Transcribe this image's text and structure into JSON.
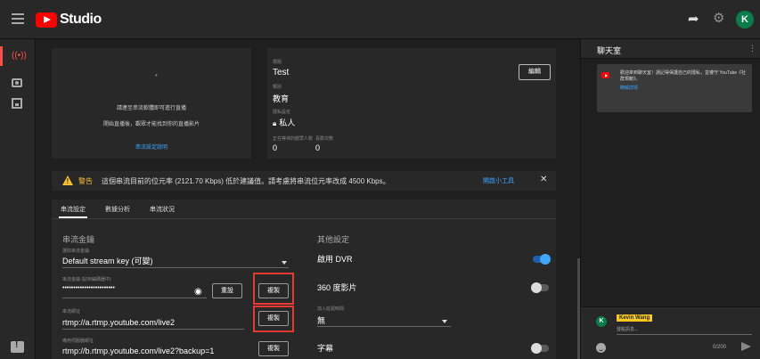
{
  "app": {
    "logo_text": "Studio",
    "avatar_letter": "K"
  },
  "preview": {
    "line1": "請連至串流軟體即可進行直播",
    "line2": "開始直播後，觀眾才能找到你的直播影片",
    "help_link": "串流設定說明"
  },
  "stream_info": {
    "title_label": "標題",
    "title": "Test",
    "category_label": "類別",
    "category": "教育",
    "privacy_label": "隱私設定",
    "privacy": "私人",
    "waiting_label": "正在等待的觀眾人數",
    "waiting": "0",
    "likes_label": "喜歡次數",
    "likes": "0",
    "edit_label": "編輯"
  },
  "warning": {
    "label": "警告",
    "text": "這個串流目前的位元率 (2121.70 Kbps) 低於建議值。請考慮將串流位元率改成 4500 Kbps。",
    "link": "開啟小工具"
  },
  "tabs": [
    {
      "label": "串流設定"
    },
    {
      "label": "數據分析"
    },
    {
      "label": "串流狀況"
    }
  ],
  "stream_key": {
    "section_title": "串流金鑰",
    "select_label": "選取串流金鑰",
    "select_value": "Default stream key (可變)",
    "key_label": "串流金鑰 (貼到編碼器中)",
    "key_value": "••••••••••••••••••••••••",
    "reset_label": "重設",
    "copy_label": "複製",
    "url_label": "串流網址",
    "url_value": "rtmp://a.rtmp.youtube.com/live2",
    "backup_label": "備用伺服器網址",
    "backup_value": "rtmp://b.rtmp.youtube.com/live2?backup=1"
  },
  "other_settings": {
    "section_title": "其他設定",
    "dvr_label": "啟用 DVR",
    "dvr_on": true,
    "vr_label": "360 度影片",
    "vr_on": false,
    "delay_label": "加入延遲時間",
    "delay_value": "無",
    "captions_label": "字幕",
    "captions_on": false
  },
  "chat": {
    "title": "聊天室",
    "welcome_text": "歡迎來到聊天室！請記得保護自己的隱私，並遵守 YouTube《社群規範》。",
    "welcome_link": "瞭解詳情",
    "user_name": "Kevin Wang",
    "user_initial": "K",
    "placeholder": "發點訊息...",
    "counter": "0/200"
  },
  "icons": {
    "menu": "menu-icon",
    "share": "share-icon",
    "settings": "gear-icon",
    "live": "live-icon",
    "camera": "camera-icon",
    "calendar": "calendar-icon",
    "feedback": "feedback-icon",
    "eye": "eye-icon",
    "lock": "lock-icon",
    "warning": "warning-icon",
    "close": "close-icon",
    "emoji": "emoji-icon",
    "send": "send-icon"
  },
  "colors": {
    "accent": "#3ea6ff",
    "brand": "#ff0000",
    "warning": "#fbc02d",
    "highlight": "#e53935"
  }
}
